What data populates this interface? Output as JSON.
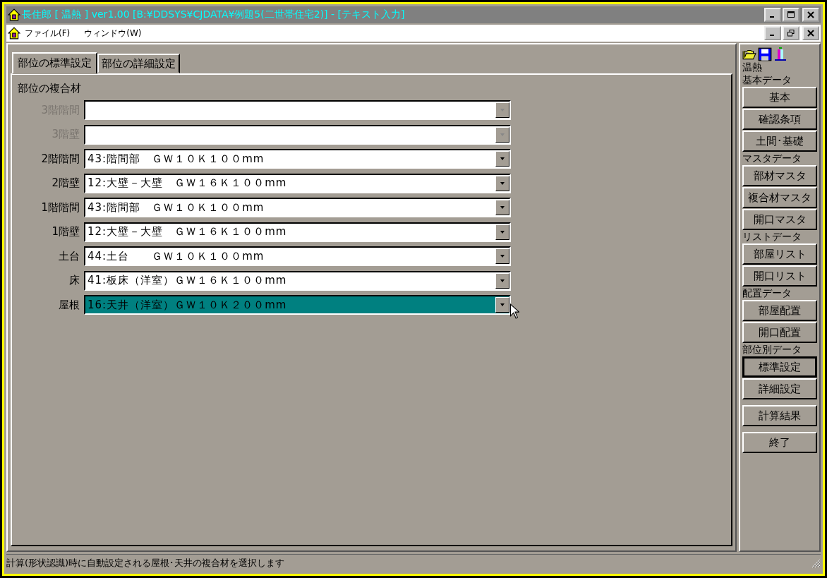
{
  "window": {
    "title": "長住郎 [ 温熱 ] ver1.00 [B:¥DDSYS¥CJDATA¥例題5(二世帯住宅2)] - [テキスト入力]"
  },
  "menu": [
    "ファイル(F)",
    "ウィンドウ(W)"
  ],
  "tabs": [
    {
      "label": "部位の標準設定",
      "selected": true
    },
    {
      "label": "部位の詳細設定",
      "selected": false
    }
  ],
  "section_title": "部位の複合材",
  "rows": [
    {
      "label": "3階階間",
      "disabled": true,
      "selected": false
    },
    {
      "label": "3階壁",
      "disabled": true,
      "selected": false
    },
    {
      "label": "2階階間",
      "value": "43:階間部　ＧＷ１０Ｋ１００mm",
      "disabled": false,
      "selected": false
    },
    {
      "label": "2階壁",
      "value": "12:大壁－大壁　ＧＷ１６Ｋ１００mm",
      "disabled": false,
      "selected": false
    },
    {
      "label": "1階階間",
      "value": "43:階間部　ＧＷ１０Ｋ１００mm",
      "disabled": false,
      "selected": false
    },
    {
      "label": "1階壁",
      "value": "12:大壁－大壁　ＧＷ１６Ｋ１００mm",
      "disabled": false,
      "selected": false
    },
    {
      "label": "土台",
      "value": "44:土台　　ＧＷ１０Ｋ１００mm",
      "disabled": false,
      "selected": false
    },
    {
      "label": "床",
      "value": "41:板床（洋室）ＧＷ１６Ｋ１００mm",
      "disabled": false,
      "selected": false
    },
    {
      "label": "屋根",
      "value": "16:天井（洋室）ＧＷ１０Ｋ２００mm",
      "disabled": false,
      "selected": true
    }
  ],
  "sidebar": {
    "caption": "温熱",
    "groups": [
      {
        "heading": "基本データ",
        "buttons": [
          {
            "label": "基本",
            "selected": false
          },
          {
            "label": "確認条項",
            "selected": false
          },
          {
            "label": "土間･基礎",
            "selected": false
          }
        ]
      },
      {
        "heading": "マスタデータ",
        "buttons": [
          {
            "label": "部材マスタ",
            "selected": false
          },
          {
            "label": "複合材マスタ",
            "selected": false
          },
          {
            "label": "開口マスタ",
            "selected": false
          }
        ]
      },
      {
        "heading": "リストデータ",
        "buttons": [
          {
            "label": "部屋リスト",
            "selected": false
          },
          {
            "label": "開口リスト",
            "selected": false
          }
        ]
      },
      {
        "heading": "配置データ",
        "buttons": [
          {
            "label": "部屋配置",
            "selected": false
          },
          {
            "label": "開口配置",
            "selected": false
          }
        ]
      },
      {
        "heading": "部位別データ",
        "buttons": [
          {
            "label": "標準設定",
            "selected": true
          },
          {
            "label": "詳細設定",
            "selected": false
          }
        ]
      },
      {
        "buttons": [
          {
            "label": "計算結果",
            "selected": false
          }
        ]
      },
      {
        "buttons": [
          {
            "label": "終了",
            "selected": false
          }
        ]
      }
    ]
  },
  "status_bar": "計算(形状認識)時に自動設定される屋根･天井の複合材を選択します"
}
